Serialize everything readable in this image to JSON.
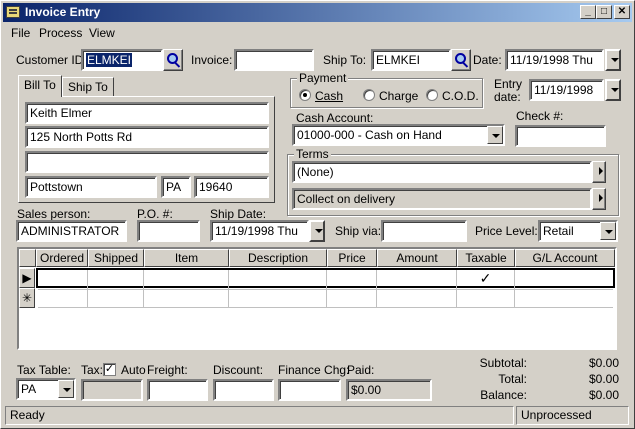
{
  "window": {
    "title": "Invoice Entry",
    "minimize": "_",
    "maximize": "□",
    "close": "✕"
  },
  "menu": [
    {
      "label": "File"
    },
    {
      "label": "Process"
    },
    {
      "label": "View"
    }
  ],
  "header": {
    "customer_id_label": "Customer ID:",
    "customer_id": "ELMKEI",
    "invoice_label": "Invoice:",
    "invoice": "",
    "ship_to_label": "Ship To:",
    "ship_to": "ELMKEI",
    "date_label": "Date:",
    "date": "11/19/1998 Thu",
    "entry_date_label_1": "Entry",
    "entry_date_label_2": "date:",
    "entry_date": "11/19/1998"
  },
  "tabs": [
    {
      "label": "Bill To"
    },
    {
      "label": "Ship To"
    }
  ],
  "bill_to": {
    "name": "Keith Elmer",
    "address1": "125 North Potts Rd",
    "address2": "",
    "city": "Pottstown",
    "state": "PA",
    "zip": "19640"
  },
  "payment": {
    "title": "Payment",
    "options": [
      {
        "label": "Cash",
        "selected": true
      },
      {
        "label": "Charge",
        "selected": false
      },
      {
        "label": "C.O.D.",
        "selected": false
      }
    ],
    "cash_account_label": "Cash Account:",
    "cash_account": "01000-000 - Cash on Hand",
    "check_label": "Check #:",
    "check": ""
  },
  "terms": {
    "title": "Terms",
    "term": "(None)",
    "description": "Collect on delivery"
  },
  "sales": {
    "salesperson_label": "Sales person:",
    "salesperson": "ADMINISTRATOR",
    "po_label": "P.O. #:",
    "po": "",
    "ship_date_label": "Ship Date:",
    "ship_date": "11/19/1998 Thu",
    "ship_via_label": "Ship via:",
    "ship_via": "",
    "price_level_label": "Price Level:",
    "price_level": "Retail"
  },
  "grid": {
    "columns": [
      "Ordered",
      "Shipped",
      "Item",
      "Description",
      "Price",
      "Amount",
      "Taxable",
      "G/L Account"
    ],
    "rows": [
      {
        "marker": "▶",
        "cells": [
          "",
          "",
          "",
          "",
          "",
          "",
          "✓",
          ""
        ]
      },
      {
        "marker": "✳",
        "cells": [
          "",
          "",
          "",
          "",
          "",
          "",
          "",
          ""
        ]
      }
    ]
  },
  "footer": {
    "tax_table_label": "Tax Table:",
    "tax_table": "PA",
    "tax_label": "Tax:",
    "tax_checked": "✓",
    "auto_label": "Auto",
    "freight_label": "Freight:",
    "freight": "",
    "discount_label": "Discount:",
    "discount": "",
    "finance_label": "Finance Chg:",
    "finance": "",
    "paid_label": "Paid:",
    "paid": "$0.00",
    "subtotal_label": "Subtotal:",
    "subtotal": "$0.00",
    "total_label": "Total:",
    "total": "$0.00",
    "balance_label": "Balance:",
    "balance": "$0.00"
  },
  "status": {
    "left": "Ready",
    "right": "Unprocessed"
  },
  "colors": {
    "titlebar_start": "#0a246a",
    "titlebar_end": "#a6caf0",
    "face": "#d4d0c8",
    "selection": "#0a246a"
  }
}
